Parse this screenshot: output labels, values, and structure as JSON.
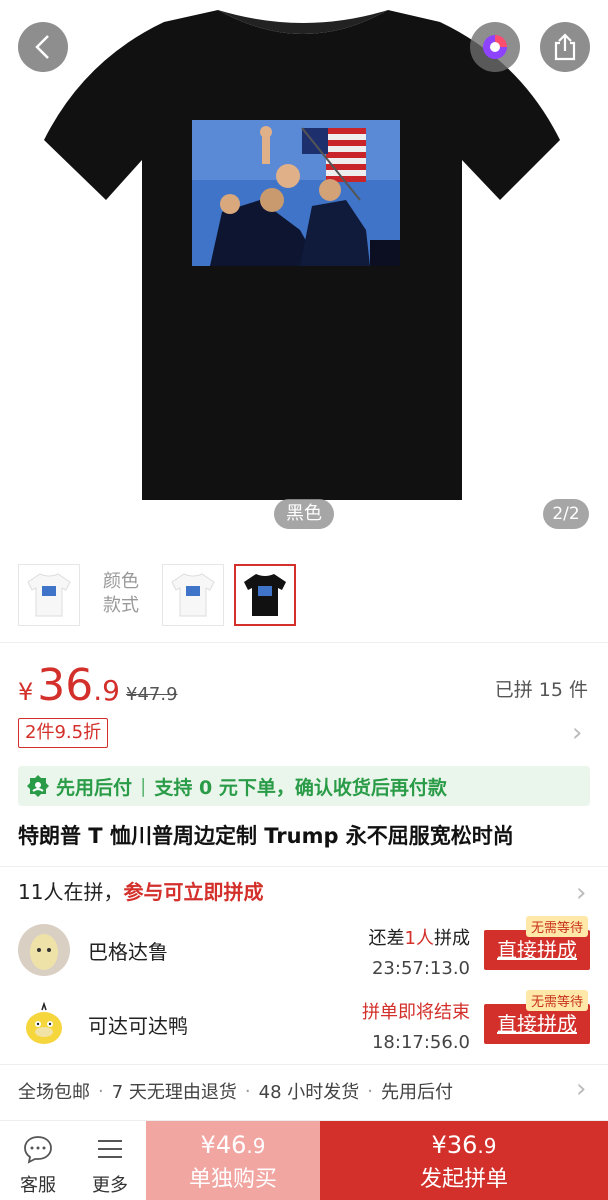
{
  "hero": {
    "color_tag": "黑色",
    "page_indicator": "2/2"
  },
  "thumbnails": {
    "color_style_label_line1": "颜色",
    "color_style_label_line2": "款式"
  },
  "price": {
    "currency": "¥",
    "integer": "36",
    "decimal": ".9",
    "original": "¥47.9",
    "sold": "已拼 15 件",
    "discount": "2件9.5折"
  },
  "paylater": {
    "label": "先用后付",
    "text1": "支持 0 元下单，",
    "text2": "确认收货后再付款"
  },
  "product": {
    "title": "特朗普 T 恤川普周边定制 Trump 永不屈服宽松时尚"
  },
  "group": {
    "count_text": "11人在拼，",
    "join_hint": "参与可立即拼成",
    "rows": [
      {
        "name": "巴格达鲁",
        "status_prefix": "还差",
        "status_highlight": "1人",
        "status_suffix": "拼成",
        "timer": "23:57:13.0",
        "badge": "无需等待",
        "button": "直接拼成"
      },
      {
        "name": "可达可达鸭",
        "status_prefix": "",
        "status_highlight": "拼单即将结束",
        "status_suffix": "",
        "timer": "18:17:56.0",
        "badge": "无需等待",
        "button": "直接拼成"
      }
    ]
  },
  "services": [
    "全场包邮",
    "7 天无理由退货",
    "48 小时发货",
    "先用后付"
  ],
  "bottom": {
    "service_label": "客服",
    "more_label": "更多",
    "alone_currency": "¥",
    "alone_int": "46",
    "alone_dec": ".9",
    "alone_label": "单独购买",
    "group_currency": "¥",
    "group_int": "36",
    "group_dec": ".9",
    "group_label": "发起拼单"
  },
  "colors": {
    "accent_red": "#d4302b",
    "light_red": "#f2a6a2",
    "pay_later_green": "#2a9b47"
  }
}
